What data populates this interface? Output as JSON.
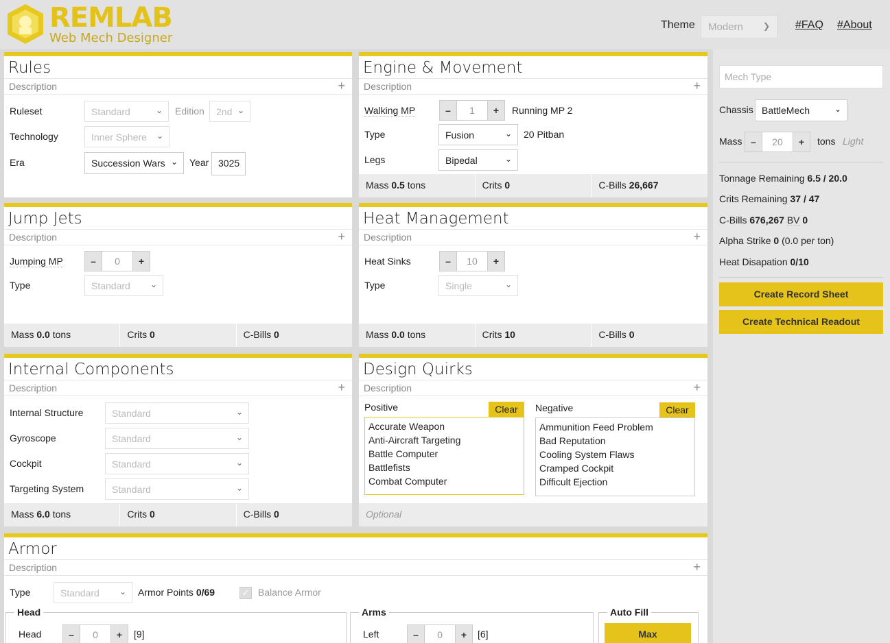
{
  "header": {
    "brand": "REMLAB",
    "subtitle": "Web Mech Designer",
    "theme_label": "Theme",
    "theme_value": "Modern",
    "faq": "#FAQ",
    "about": "#About"
  },
  "rules": {
    "title": "Rules",
    "description": "Description",
    "ruleset_label": "Ruleset",
    "ruleset": "Standard",
    "edition_label": "Edition",
    "edition": "2nd",
    "technology_label": "Technology",
    "technology": "Inner Sphere",
    "era_label": "Era",
    "era": "Succession Wars",
    "year_label": "Year",
    "year": "3025"
  },
  "engine": {
    "title": "Engine & Movement",
    "description": "Description",
    "walking_label": "Walking MP",
    "walking": "1",
    "running_label": "Running MP 2",
    "type_label": "Type",
    "type": "Fusion",
    "engine_rating": "20 Pitban",
    "legs_label": "Legs",
    "legs": "Bipedal",
    "mass_label": "Mass",
    "mass": "0.5",
    "mass_unit": "tons",
    "crits_label": "Crits",
    "crits": "0",
    "cbills_label": "C-Bills",
    "cbills": "26,667"
  },
  "jump": {
    "title": "Jump Jets",
    "description": "Description",
    "jumping_label": "Jumping MP",
    "jumping": "0",
    "type_label": "Type",
    "type": "Standard",
    "mass_label": "Mass",
    "mass": "0.0",
    "mass_unit": "tons",
    "crits_label": "Crits",
    "crits": "0",
    "cbills_label": "C-Bills",
    "cbills": "0"
  },
  "heat": {
    "title": "Heat Management",
    "description": "Description",
    "sinks_label": "Heat Sinks",
    "sinks": "10",
    "type_label": "Type",
    "type": "Single",
    "mass_label": "Mass",
    "mass": "0.0",
    "mass_unit": "tons",
    "crits_label": "Crits",
    "crits": "10",
    "cbills_label": "C-Bills",
    "cbills": "0"
  },
  "internal": {
    "title": "Internal Components",
    "description": "Description",
    "structure_label": "Internal Structure",
    "structure": "Standard",
    "gyro_label": "Gyroscope",
    "gyro": "Standard",
    "cockpit_label": "Cockpit",
    "cockpit": "Standard",
    "targeting_label": "Targeting System",
    "targeting": "Standard",
    "mass_label": "Mass",
    "mass": "6.0",
    "mass_unit": "tons",
    "crits_label": "Crits",
    "crits": "0",
    "cbills_label": "C-Bills",
    "cbills": "0"
  },
  "quirks": {
    "title": "Design Quirks",
    "description": "Description",
    "positive_label": "Positive",
    "negative_label": "Negative",
    "clear": "Clear",
    "positive": [
      "Accurate Weapon",
      "Anti-Aircraft Targeting",
      "Battle Computer",
      "Battlefists",
      "Combat Computer"
    ],
    "negative": [
      "Ammunition Feed Problem",
      "Bad Reputation",
      "Cooling System Flaws",
      "Cramped Cockpit",
      "Difficult Ejection"
    ],
    "optional": "Optional"
  },
  "armor": {
    "title": "Armor",
    "description": "Description",
    "type_label": "Type",
    "type": "Standard",
    "points_label": "Armor Points",
    "points": "0/69",
    "balance": "Balance Armor",
    "head_legend": "Head",
    "head_label": "Head",
    "head_value": "0",
    "head_max": "[9]",
    "arms_legend": "Arms",
    "left_label": "Left",
    "left_value": "0",
    "left_max": "[6]",
    "autofill_legend": "Auto Fill",
    "max": "Max"
  },
  "side": {
    "mech_type_placeholder": "Mech Type",
    "chassis_label": "Chassis",
    "chassis": "BattleMech",
    "mass_label": "Mass",
    "mass": "20",
    "mass_unit": "tons",
    "weight_class": "Light",
    "tonnage_label": "Tonnage Remaining",
    "tonnage": "6.5 / 20.0",
    "crits_label": "Crits Remaining",
    "crits": "37 / 47",
    "cbills_label": "C-Bills",
    "cbills": "676,267",
    "bv_label": "BV",
    "bv": "0",
    "alpha_label": "Alpha Strike",
    "alpha": "0",
    "alpha_per": "(0.0 per ton)",
    "heat_label": "Heat Disapation",
    "heat": "0/10",
    "record_sheet": "Create Record Sheet",
    "tech_readout": "Create Technical Readout"
  }
}
